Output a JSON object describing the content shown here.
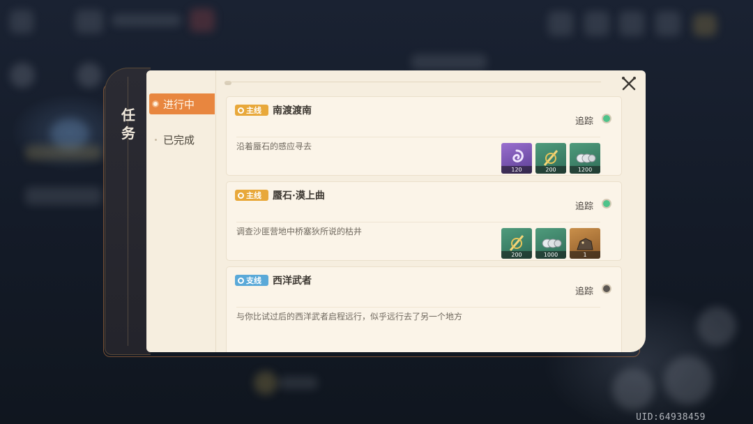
{
  "sidebar": {
    "title": "任务"
  },
  "tabs": [
    {
      "label": "进行中",
      "active": true
    },
    {
      "label": "已完成",
      "active": false
    }
  ],
  "quests": [
    {
      "tag": "主线",
      "tag_type": "main",
      "title": "南渡渡南",
      "track_label": "追踪",
      "tracked": true,
      "description": "沿着蜃石的感应寻去",
      "rewards": [
        {
          "icon": "purple-swirl-icon",
          "qty": "120",
          "bg": "purple"
        },
        {
          "icon": "golden-sword-icon",
          "qty": "200",
          "bg": "green"
        },
        {
          "icon": "silver-coins-icon",
          "qty": "1200",
          "bg": "green"
        }
      ]
    },
    {
      "tag": "主线",
      "tag_type": "main",
      "title": "蜃石·漠上曲",
      "track_label": "追踪",
      "tracked": true,
      "description": "调查沙匪营地中桥塞狄所说的枯井",
      "rewards": [
        {
          "icon": "golden-sword-icon",
          "qty": "200",
          "bg": "green"
        },
        {
          "icon": "silver-coins-icon",
          "qty": "1000",
          "bg": "green"
        },
        {
          "icon": "creature-figurine-icon",
          "qty": "1",
          "bg": "gold"
        }
      ]
    },
    {
      "tag": "支线",
      "tag_type": "side",
      "title": "西洋武者",
      "track_label": "追踪",
      "tracked": false,
      "description": "与你比试过后的西洋武者启程远行，似乎远行去了另一个地方",
      "rewards": []
    }
  ],
  "uid": "UID:64938459",
  "colors": {
    "accent": "#e8863f",
    "panel": "#f6eedf",
    "track_on": "#4ec38a",
    "main_tag": "#e8a83a",
    "side_tag": "#5aa9d8"
  }
}
